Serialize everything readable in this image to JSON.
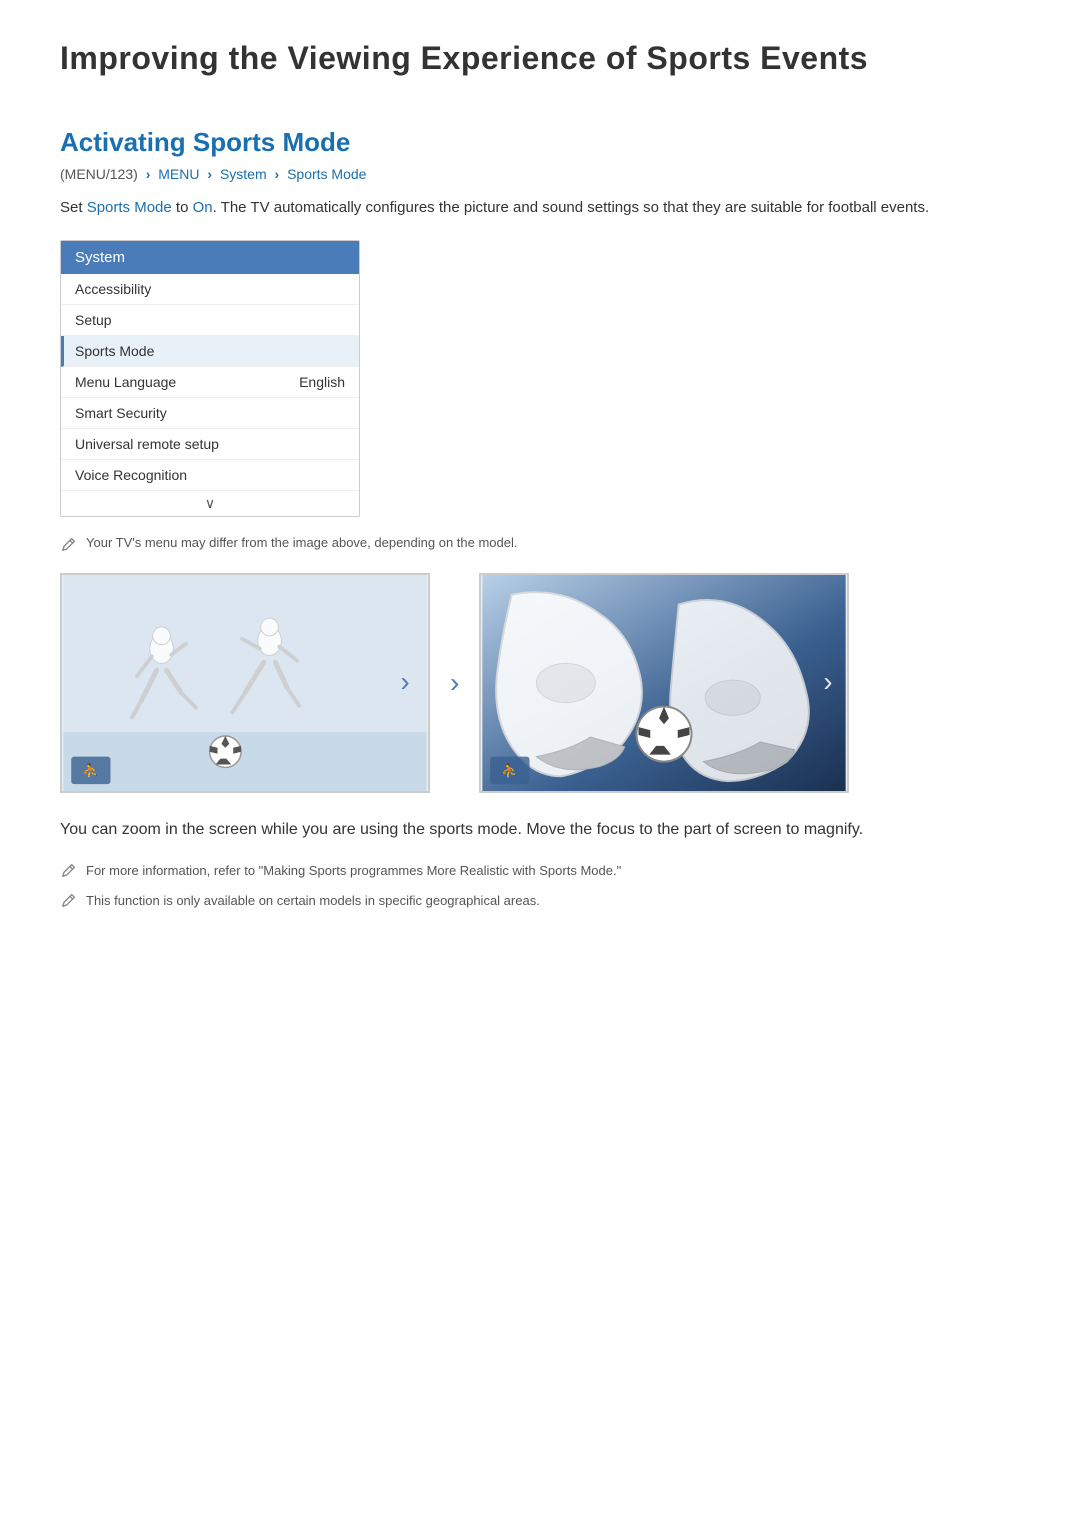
{
  "page": {
    "title": "Improving the Viewing Experience of Sports Events"
  },
  "section": {
    "title": "Activating Sports Mode",
    "breadcrumb": {
      "menu_num": "(MENU/123)",
      "parts": [
        "MENU",
        "System",
        "Sports Mode"
      ]
    },
    "description_parts": [
      "Set ",
      "Sports Mode",
      " to ",
      "On",
      ". The TV automatically configures the picture and sound settings so that they are suitable for football events."
    ]
  },
  "menu": {
    "title": "System",
    "items": [
      {
        "label": "Accessibility",
        "value": "",
        "state": "normal"
      },
      {
        "label": "Setup",
        "value": "",
        "state": "normal"
      },
      {
        "label": "Sports Mode",
        "value": "",
        "state": "selected"
      },
      {
        "label": "Menu Language",
        "value": "English",
        "state": "normal"
      },
      {
        "label": "Smart Security",
        "value": "",
        "state": "normal"
      },
      {
        "label": "Universal remote setup",
        "value": "",
        "state": "normal"
      },
      {
        "label": "Voice Recognition",
        "value": "",
        "state": "normal"
      }
    ]
  },
  "note_above_images": "Your TV's menu may differ from the image above, depending on the model.",
  "body_text": "You can zoom in the screen while you are using the sports mode. Move the focus to the part of screen to magnify.",
  "footer_notes": [
    "For more information, refer to \"Making Sports programmes More Realistic with Sports Mode.\"",
    "This function is only available on certain models in specific geographical areas."
  ],
  "nav_arrow": "›",
  "chevron_down": "∨",
  "colors": {
    "accent": "#1a6faf",
    "menu_header_bg": "#4a7cba",
    "selected_bg": "#e8f0f8"
  }
}
